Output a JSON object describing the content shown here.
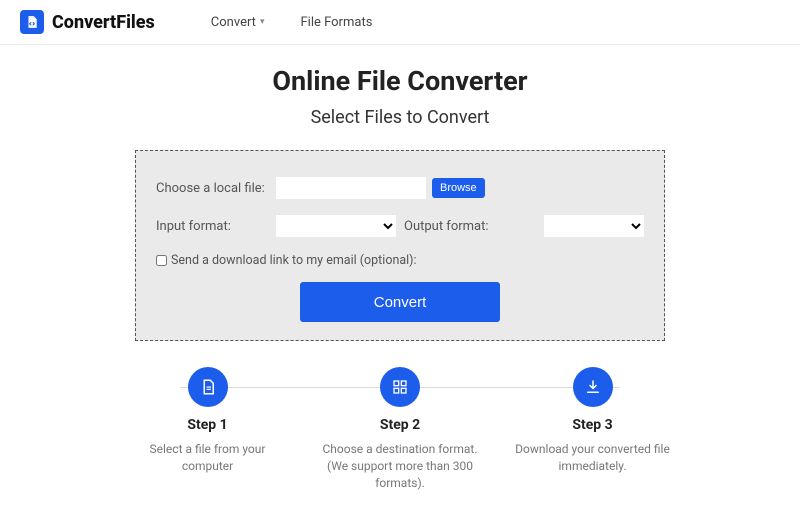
{
  "brand": {
    "name": "ConvertFiles"
  },
  "nav": {
    "convert": "Convert",
    "formats": "File Formats"
  },
  "hero": {
    "title": "Online File Converter",
    "subtitle": "Select Files to Convert"
  },
  "form": {
    "choose_label": "Choose a local file:",
    "file_value": "",
    "browse": "Browse",
    "input_format_label": "Input format:",
    "output_format_label": "Output format:",
    "input_format_value": "",
    "output_format_value": "",
    "email_label": "Send a download link to my email (optional):",
    "convert": "Convert"
  },
  "steps": [
    {
      "title": "Step 1",
      "desc": "Select a file from your computer"
    },
    {
      "title": "Step 2",
      "desc": "Choose a destination format. (We support more than 300 formats)."
    },
    {
      "title": "Step 3",
      "desc": "Download your converted file immediately."
    }
  ]
}
